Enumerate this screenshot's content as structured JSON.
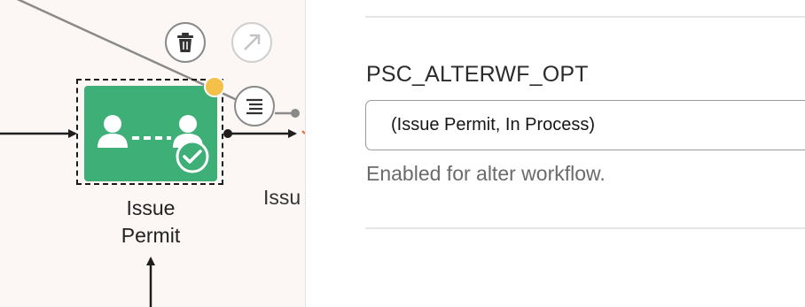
{
  "canvas": {
    "nodes": [
      {
        "label": "Issue Permit",
        "selected": true,
        "status": "completed"
      },
      {
        "label": "Issu"
      }
    ],
    "node_actions": {
      "delete": "trash-icon",
      "link": "arrow-up-right-icon",
      "menu": "list-icon"
    },
    "colors": {
      "node_fill": "#3eaf76",
      "status_dot": "#f5c04a",
      "background": "#fcf7f5"
    }
  },
  "properties": {
    "field_label": "PSC_ALTERWF_OPT",
    "field_value": "(Issue Permit, In Process)",
    "help_text": "Enabled for alter workflow."
  }
}
